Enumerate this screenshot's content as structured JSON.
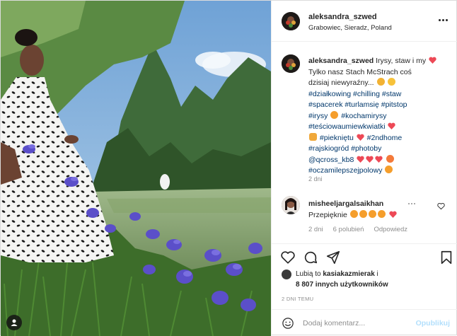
{
  "post": {
    "username": "aleksandra_szwed",
    "location": "Grabowiec, Sieradz, Poland",
    "caption_line1_text": "Irysy, staw i my",
    "caption_line2": "Tylko nasz Stach McStrach coś",
    "caption_line3": "dzisiaj niewyraźny...",
    "tags": {
      "t1": "#działkowing",
      "t2": "#chilling",
      "t3": "#staw",
      "t4": "#spacerek",
      "t5": "#turlamsię",
      "t6": "#pitstop",
      "t7": "#irysy",
      "t8": "#kochamirysy",
      "t9": "#teściowaumiewkwiatki",
      "t10": "#piekniętu",
      "t11": "#2ndhome",
      "t12": "#rajskiogród",
      "t13": "#photoby",
      "t14": "@qcross_kb8",
      "t15": "#oczamilepszejpolowy"
    },
    "caption_time": "2 dni"
  },
  "comment": {
    "username": "misheeljargalsaikhan",
    "text": "Przepięknie",
    "time": "2 dni",
    "likes": "6 polubień",
    "reply": "Odpowiedz"
  },
  "likes": {
    "prefix": "Lubią to ",
    "user": "kasiakazmierak",
    "suffix": " i",
    "others": "8 807 innych użytkowników"
  },
  "post_time": "2 DNI TEMU",
  "comment_input": {
    "placeholder": "Dodaj komentarz...",
    "publish_label": "Opublikuj"
  },
  "colors": {
    "link": "#00376b",
    "publish_disabled": "#b2dffc",
    "like_red": "#ed4956"
  },
  "icons": [
    "heart-icon",
    "comment-icon",
    "share-icon",
    "bookmark-icon",
    "more-icon",
    "smile-icon",
    "user-tag-icon"
  ]
}
